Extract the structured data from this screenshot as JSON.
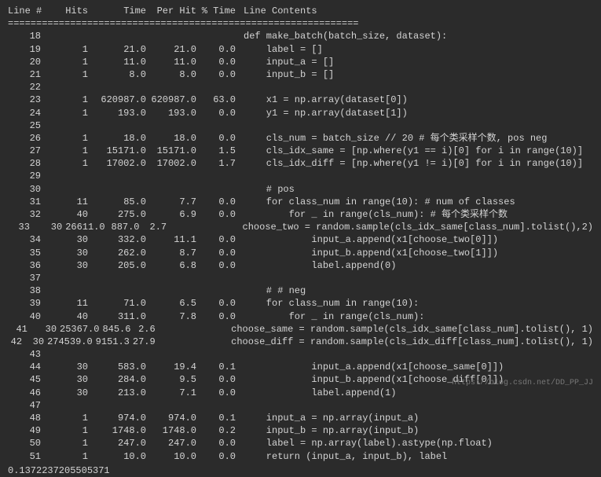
{
  "header": {
    "line": "Line #",
    "hits": "Hits",
    "time": "Time",
    "perhit": "Per Hit",
    "pct": "% Time",
    "contents": "Line Contents"
  },
  "separator": "==============================================================",
  "rows": [
    {
      "line": "18",
      "hits": "",
      "time": "",
      "perhit": "",
      "pct": "",
      "code": "def make_batch(batch_size, dataset):"
    },
    {
      "line": "19",
      "hits": "1",
      "time": "21.0",
      "perhit": "21.0",
      "pct": "0.0",
      "code": "    label = []"
    },
    {
      "line": "20",
      "hits": "1",
      "time": "11.0",
      "perhit": "11.0",
      "pct": "0.0",
      "code": "    input_a = []"
    },
    {
      "line": "21",
      "hits": "1",
      "time": "8.0",
      "perhit": "8.0",
      "pct": "0.0",
      "code": "    input_b = []"
    },
    {
      "line": "22",
      "hits": "",
      "time": "",
      "perhit": "",
      "pct": "",
      "code": ""
    },
    {
      "line": "23",
      "hits": "1",
      "time": "620987.0",
      "perhit": "620987.0",
      "pct": "63.0",
      "code": "    x1 = np.array(dataset[0])"
    },
    {
      "line": "24",
      "hits": "1",
      "time": "193.0",
      "perhit": "193.0",
      "pct": "0.0",
      "code": "    y1 = np.array(dataset[1])"
    },
    {
      "line": "25",
      "hits": "",
      "time": "",
      "perhit": "",
      "pct": "",
      "code": ""
    },
    {
      "line": "26",
      "hits": "1",
      "time": "18.0",
      "perhit": "18.0",
      "pct": "0.0",
      "code": "    cls_num = batch_size // 20 # 每个类采样个数, pos neg"
    },
    {
      "line": "27",
      "hits": "1",
      "time": "15171.0",
      "perhit": "15171.0",
      "pct": "1.5",
      "code": "    cls_idx_same = [np.where(y1 == i)[0] for i in range(10)]"
    },
    {
      "line": "28",
      "hits": "1",
      "time": "17002.0",
      "perhit": "17002.0",
      "pct": "1.7",
      "code": "    cls_idx_diff = [np.where(y1 != i)[0] for i in range(10)]"
    },
    {
      "line": "29",
      "hits": "",
      "time": "",
      "perhit": "",
      "pct": "",
      "code": ""
    },
    {
      "line": "30",
      "hits": "",
      "time": "",
      "perhit": "",
      "pct": "",
      "code": "    # pos"
    },
    {
      "line": "31",
      "hits": "11",
      "time": "85.0",
      "perhit": "7.7",
      "pct": "0.0",
      "code": "    for class_num in range(10): # num of classes"
    },
    {
      "line": "32",
      "hits": "40",
      "time": "275.0",
      "perhit": "6.9",
      "pct": "0.0",
      "code": "        for _ in range(cls_num): # 每个类采样个数"
    },
    {
      "line": "33",
      "hits": "30",
      "time": "26611.0",
      "perhit": "887.0",
      "pct": "2.7",
      "code": "            choose_two = random.sample(cls_idx_same[class_num].tolist(),2)"
    },
    {
      "line": "34",
      "hits": "30",
      "time": "332.0",
      "perhit": "11.1",
      "pct": "0.0",
      "code": "            input_a.append(x1[choose_two[0]])"
    },
    {
      "line": "35",
      "hits": "30",
      "time": "262.0",
      "perhit": "8.7",
      "pct": "0.0",
      "code": "            input_b.append(x1[choose_two[1]])"
    },
    {
      "line": "36",
      "hits": "30",
      "time": "205.0",
      "perhit": "6.8",
      "pct": "0.0",
      "code": "            label.append(0)"
    },
    {
      "line": "37",
      "hits": "",
      "time": "",
      "perhit": "",
      "pct": "",
      "code": ""
    },
    {
      "line": "38",
      "hits": "",
      "time": "",
      "perhit": "",
      "pct": "",
      "code": "    # # neg"
    },
    {
      "line": "39",
      "hits": "11",
      "time": "71.0",
      "perhit": "6.5",
      "pct": "0.0",
      "code": "    for class_num in range(10):"
    },
    {
      "line": "40",
      "hits": "40",
      "time": "311.0",
      "perhit": "7.8",
      "pct": "0.0",
      "code": "        for _ in range(cls_num):"
    },
    {
      "line": "41",
      "hits": "30",
      "time": "25367.0",
      "perhit": "845.6",
      "pct": "2.6",
      "code": "            choose_same = random.sample(cls_idx_same[class_num].tolist(), 1)"
    },
    {
      "line": "42",
      "hits": "30",
      "time": "274539.0",
      "perhit": "9151.3",
      "pct": "27.9",
      "code": "            choose_diff = random.sample(cls_idx_diff[class_num].tolist(), 1)"
    },
    {
      "line": "43",
      "hits": "",
      "time": "",
      "perhit": "",
      "pct": "",
      "code": ""
    },
    {
      "line": "44",
      "hits": "30",
      "time": "583.0",
      "perhit": "19.4",
      "pct": "0.1",
      "code": "            input_a.append(x1[choose_same[0]])"
    },
    {
      "line": "45",
      "hits": "30",
      "time": "284.0",
      "perhit": "9.5",
      "pct": "0.0",
      "code": "            input_b.append(x1[choose_diff[0]])"
    },
    {
      "line": "46",
      "hits": "30",
      "time": "213.0",
      "perhit": "7.1",
      "pct": "0.0",
      "code": "            label.append(1)"
    },
    {
      "line": "47",
      "hits": "",
      "time": "",
      "perhit": "",
      "pct": "",
      "code": ""
    },
    {
      "line": "48",
      "hits": "1",
      "time": "974.0",
      "perhit": "974.0",
      "pct": "0.1",
      "code": "    input_a = np.array(input_a)"
    },
    {
      "line": "49",
      "hits": "1",
      "time": "1748.0",
      "perhit": "1748.0",
      "pct": "0.2",
      "code": "    input_b = np.array(input_b)"
    },
    {
      "line": "50",
      "hits": "1",
      "time": "247.0",
      "perhit": "247.0",
      "pct": "0.0",
      "code": "    label = np.array(label).astype(np.float)"
    },
    {
      "line": "51",
      "hits": "1",
      "time": "10.0",
      "perhit": "10.0",
      "pct": "0.0",
      "code": "    return (input_a, input_b), label"
    }
  ],
  "footer_number": "0.1372237205505371",
  "watermark": "https://blog.csdn.net/DD_PP_JJ"
}
